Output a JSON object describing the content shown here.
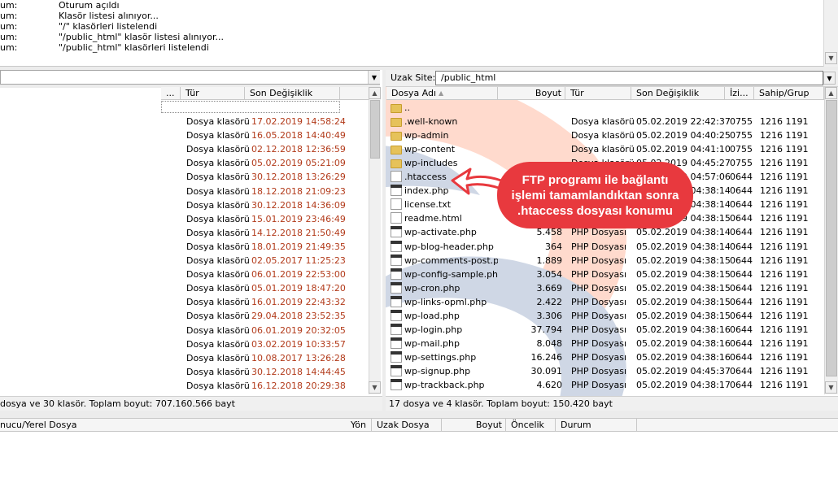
{
  "log": {
    "rows": [
      {
        "label": "um:",
        "message": "Oturum açıldı"
      },
      {
        "label": "um:",
        "message": "Klasör listesi alınıyor..."
      },
      {
        "label": "um:",
        "message": "\"/\" klasörleri listelendi"
      },
      {
        "label": "um:",
        "message": "\"/public_html\" klasör listesi alınıyor..."
      },
      {
        "label": "um:",
        "message": "\"/public_html\" klasörleri listelendi"
      }
    ]
  },
  "local": {
    "path_value": "",
    "headers": {
      "dots": "...",
      "type": "Tür",
      "modified": "Son Değişiklik"
    },
    "rows": [
      {
        "type": "Dosya klasörü",
        "modified": "17.02.2019 14:58:24"
      },
      {
        "type": "Dosya klasörü",
        "modified": "16.05.2018 14:40:49"
      },
      {
        "type": "Dosya klasörü",
        "modified": "02.12.2018 12:36:59"
      },
      {
        "type": "Dosya klasörü",
        "modified": "05.02.2019 05:21:09"
      },
      {
        "type": "Dosya klasörü",
        "modified": "30.12.2018 13:26:29"
      },
      {
        "type": "Dosya klasörü",
        "modified": "18.12.2018 21:09:23"
      },
      {
        "type": "Dosya klasörü",
        "modified": "30.12.2018 14:36:09"
      },
      {
        "type": "Dosya klasörü",
        "modified": "15.01.2019 23:46:49"
      },
      {
        "type": "Dosya klasörü",
        "modified": "14.12.2018 21:50:49"
      },
      {
        "type": "Dosya klasörü",
        "modified": "18.01.2019 21:49:35"
      },
      {
        "type": "Dosya klasörü",
        "modified": "02.05.2017 11:25:23"
      },
      {
        "type": "Dosya klasörü",
        "modified": "06.01.2019 22:53:00"
      },
      {
        "type": "Dosya klasörü",
        "modified": "05.01.2019 18:47:20"
      },
      {
        "type": "Dosya klasörü",
        "modified": "16.01.2019 22:43:32"
      },
      {
        "type": "Dosya klasörü",
        "modified": "29.04.2018 23:52:35"
      },
      {
        "type": "Dosya klasörü",
        "modified": "06.01.2019 20:32:05"
      },
      {
        "type": "Dosya klasörü",
        "modified": "03.02.2019 10:33:57"
      },
      {
        "type": "Dosya klasörü",
        "modified": "10.08.2017 13:26:28"
      },
      {
        "type": "Dosya klasörü",
        "modified": "30.12.2018 14:44:45"
      },
      {
        "type": "Dosya klasörü",
        "modified": "16.12.2018 20:29:38"
      }
    ],
    "status": "dosya ve 30 klasör. Toplam boyut: 707.160.566 bayt"
  },
  "remote": {
    "site_label": "Uzak Site:",
    "path_value": "/public_html",
    "headers": {
      "name": "Dosya Adı",
      "size": "Boyut",
      "type": "Tür",
      "modified": "Son Değişiklik",
      "perm": "İzi...",
      "owner": "Sahip/Grup"
    },
    "rows": [
      {
        "icon": "folder",
        "name": "..",
        "size": "",
        "type": "",
        "modified": "",
        "perm": "",
        "owner": ""
      },
      {
        "icon": "folder",
        "name": ".well-known",
        "size": "",
        "type": "Dosya klasörü",
        "modified": "05.02.2019 22:42:37",
        "perm": "0755",
        "owner": "1216 1191"
      },
      {
        "icon": "folder",
        "name": "wp-admin",
        "size": "",
        "type": "Dosya klasörü",
        "modified": "05.02.2019 04:40:25",
        "perm": "0755",
        "owner": "1216 1191"
      },
      {
        "icon": "folder",
        "name": "wp-content",
        "size": "",
        "type": "Dosya klasörü",
        "modified": "05.02.2019 04:41:10",
        "perm": "0755",
        "owner": "1216 1191"
      },
      {
        "icon": "folder",
        "name": "wp-includes",
        "size": "",
        "type": "Dosya klasörü",
        "modified": "05.02.2019 04:45:27",
        "perm": "0755",
        "owner": "1216 1191"
      },
      {
        "icon": "doc",
        "name": ".htaccess",
        "size": "",
        "type": "",
        "modified": "05.02.2019 04:57:06",
        "perm": "0644",
        "owner": "1216 1191"
      },
      {
        "icon": "php",
        "name": "index.php",
        "size": "",
        "type": "",
        "modified": "05.02.2019 04:38:14",
        "perm": "0644",
        "owner": "1216 1191"
      },
      {
        "icon": "doc",
        "name": "license.txt",
        "size": "",
        "type": "",
        "modified": "05.02.2019 04:38:14",
        "perm": "0644",
        "owner": "1216 1191"
      },
      {
        "icon": "doc",
        "name": "readme.html",
        "size": "",
        "type": "",
        "modified": "05.02.2019 04:38:15",
        "perm": "0644",
        "owner": "1216 1191"
      },
      {
        "icon": "php",
        "name": "wp-activate.php",
        "size": "5.458",
        "type": "PHP Dosyası",
        "modified": "05.02.2019 04:38:14",
        "perm": "0644",
        "owner": "1216 1191"
      },
      {
        "icon": "php",
        "name": "wp-blog-header.php",
        "size": "364",
        "type": "PHP Dosyası",
        "modified": "05.02.2019 04:38:14",
        "perm": "0644",
        "owner": "1216 1191"
      },
      {
        "icon": "php",
        "name": "wp-comments-post.php",
        "size": "1.889",
        "type": "PHP Dosyası",
        "modified": "05.02.2019 04:38:15",
        "perm": "0644",
        "owner": "1216 1191"
      },
      {
        "icon": "php",
        "name": "wp-config-sample.php",
        "size": "3.054",
        "type": "PHP Dosyası",
        "modified": "05.02.2019 04:38:15",
        "perm": "0644",
        "owner": "1216 1191"
      },
      {
        "icon": "php",
        "name": "wp-cron.php",
        "size": "3.669",
        "type": "PHP Dosyası",
        "modified": "05.02.2019 04:38:15",
        "perm": "0644",
        "owner": "1216 1191"
      },
      {
        "icon": "php",
        "name": "wp-links-opml.php",
        "size": "2.422",
        "type": "PHP Dosyası",
        "modified": "05.02.2019 04:38:15",
        "perm": "0644",
        "owner": "1216 1191"
      },
      {
        "icon": "php",
        "name": "wp-load.php",
        "size": "3.306",
        "type": "PHP Dosyası",
        "modified": "05.02.2019 04:38:15",
        "perm": "0644",
        "owner": "1216 1191"
      },
      {
        "icon": "php",
        "name": "wp-login.php",
        "size": "37.794",
        "type": "PHP Dosyası",
        "modified": "05.02.2019 04:38:16",
        "perm": "0644",
        "owner": "1216 1191"
      },
      {
        "icon": "php",
        "name": "wp-mail.php",
        "size": "8.048",
        "type": "PHP Dosyası",
        "modified": "05.02.2019 04:38:16",
        "perm": "0644",
        "owner": "1216 1191"
      },
      {
        "icon": "php",
        "name": "wp-settings.php",
        "size": "16.246",
        "type": "PHP Dosyası",
        "modified": "05.02.2019 04:38:16",
        "perm": "0644",
        "owner": "1216 1191"
      },
      {
        "icon": "php",
        "name": "wp-signup.php",
        "size": "30.091",
        "type": "PHP Dosyası",
        "modified": "05.02.2019 04:45:37",
        "perm": "0644",
        "owner": "1216 1191"
      },
      {
        "icon": "php",
        "name": "wp-trackback.php",
        "size": "4.620",
        "type": "PHP Dosyası",
        "modified": "05.02.2019 04:38:17",
        "perm": "0644",
        "owner": "1216 1191"
      }
    ],
    "status": "17 dosya ve 4 klasör. Toplam boyut: 150.420 bayt"
  },
  "queue": {
    "headers": {
      "local_file": "nucu/Yerel Dosya",
      "direction": "Yön",
      "remote_file": "Uzak Dosya",
      "size": "Boyut",
      "priority": "Öncelik",
      "status": "Durum"
    }
  },
  "callout": {
    "line1": "FTP programı ile bağlantı",
    "line2": "işlemi tamamlandıktan sonra",
    "line3": ".htaccess dosyası konumu"
  },
  "colors": {
    "callout": "#e8393e",
    "date_red": "#b23a1a",
    "folder": "#e6c25a"
  }
}
